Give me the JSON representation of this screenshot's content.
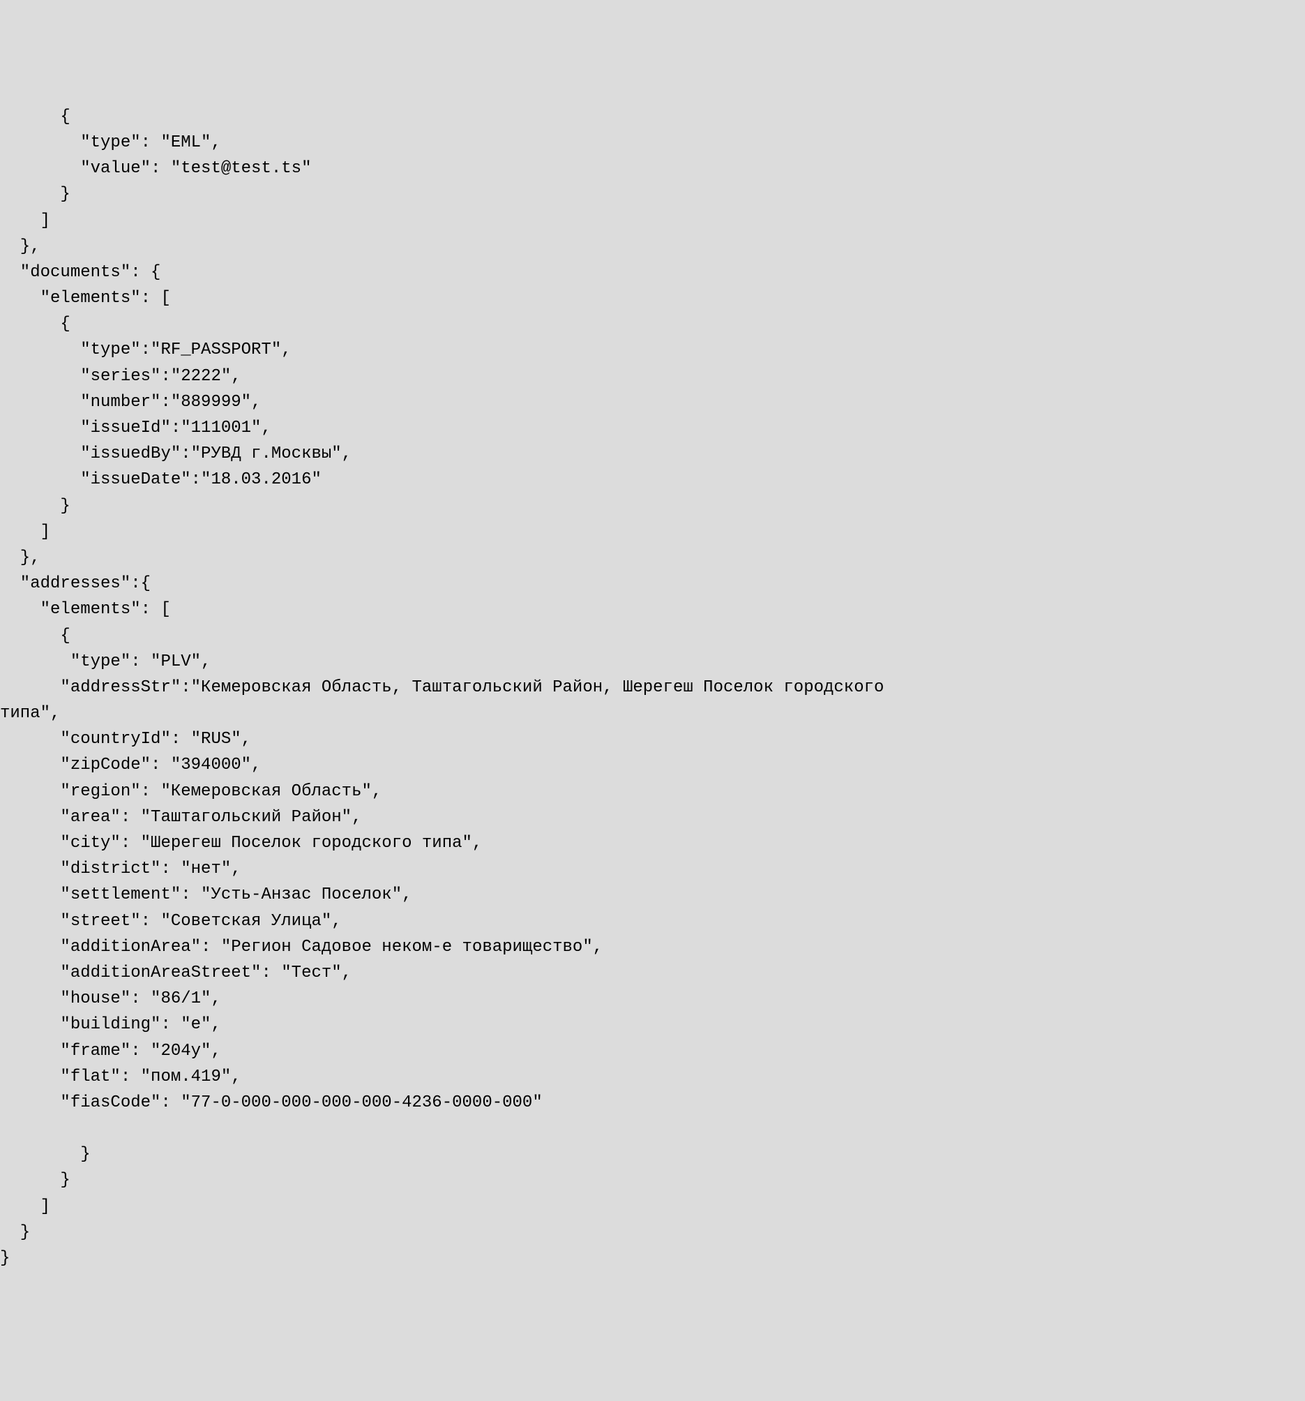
{
  "code_text": "      {\n        \"type\": \"EML\",\n        \"value\": \"test@test.ts\"\n      }\n    ]\n  },\n  \"documents\": {\n    \"elements\": [\n      {\n        \"type\":\"RF_PASSPORT\",\n        \"series\":\"2222\",\n        \"number\":\"889999\",\n        \"issueId\":\"111001\",\n        \"issuedBy\":\"РУВД г.Москвы\",\n        \"issueDate\":\"18.03.2016\"\n      }\n    ]\n  },\n  \"addresses\":{\n    \"elements\": [\n      {\n       \"type\": \"PLV\",\n      \"addressStr\":\"Кемеровская Область, Таштагольский Район, Шерегеш Поселок городского\nтипа\",\n      \"countryId\": \"RUS\",\n      \"zipCode\": \"394000\",\n      \"region\": \"Кемеровская Область\",\n      \"area\": \"Таштагольский Район\",\n      \"city\": \"Шерегеш Поселок городского типа\",\n      \"district\": \"нет\",\n      \"settlement\": \"Усть-Анзас Поселок\",\n      \"street\": \"Советская Улица\",\n      \"additionArea\": \"Регион Садовое неком-е товарищество\",\n      \"additionAreaStreet\": \"Тест\",\n      \"house\": \"86/1\",\n      \"building\": \"е\",\n      \"frame\": \"204у\",\n      \"flat\": \"пом.419\",\n      \"fiasCode\": \"77-0-000-000-000-000-4236-0000-000\"\n\n        }\n      }\n    ]\n  }\n}"
}
